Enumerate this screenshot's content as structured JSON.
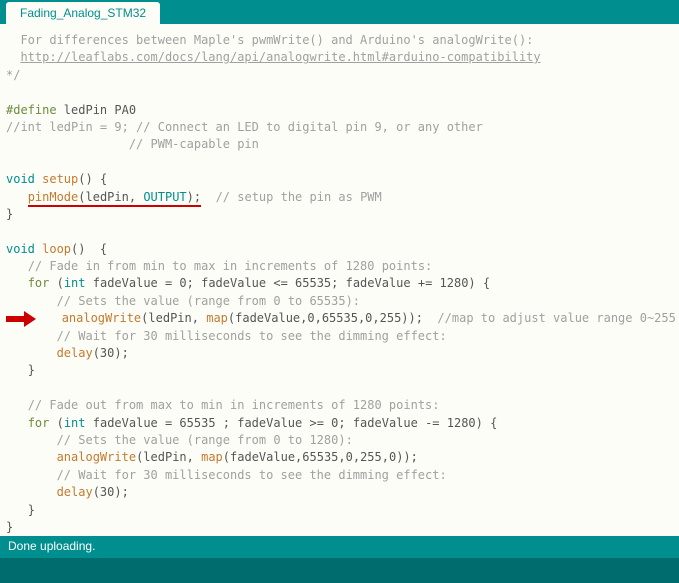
{
  "tab": {
    "title": "Fading_Analog_STM32"
  },
  "code": {
    "c1a": "  For differences between Maple's pwmWrite() and Arduino's analogWrite():",
    "link": "http://leaflabs.com/docs/lang/api/analogwrite.html#arduino-compatibility",
    "c1c": "*/",
    "define_kw": "#define",
    "define_rest": " ledPin PA0",
    "c2": "//int ledPin = 9; // Connect an LED to digital pin 9, or any other",
    "c3": "                 // PWM-capable pin",
    "void1": "void",
    "setup": " setup",
    "setup_rest": "() {",
    "pinMode": "pinMode",
    "ledPin": "ledPin",
    "output": "OUTPUT",
    "c4": "  // setup the pin as PWM",
    "brace_close": "}",
    "void2": "void",
    "loop": " loop",
    "loop_rest": "()  {",
    "c5": "// Fade in from min to max in increments of 1280 points:",
    "for1": "for",
    "int1": "int",
    "for1_rest": " fadeValue = 0; fadeValue <= 65535; fadeValue += 1280) {",
    "c6": "// Sets the value (range from 0 to 65535):",
    "analogWrite": "analogWrite",
    "map": "map",
    "map1_args": "(fadeValue,0,65535,0,255));",
    "c7": "  //map to adjust value range 0~255",
    "c8": "// Wait for 30 milliseconds to see the dimming effect:",
    "delay": "delay",
    "delay_arg": "(30);",
    "c9": "// Fade out from max to min in increments of 1280 points:",
    "for2": "for",
    "int2": "int",
    "for2_rest": " fadeValue = 65535 ; fadeValue >= 0; fadeValue -= 1280) {",
    "c10": "// Sets the value (range from 0 to 1280):",
    "map2_args": "(fadeValue,65535,0,255,0));",
    "c11": "// Wait for 30 milliseconds to see the dimming effect:"
  },
  "status": {
    "message": "Done uploading."
  }
}
